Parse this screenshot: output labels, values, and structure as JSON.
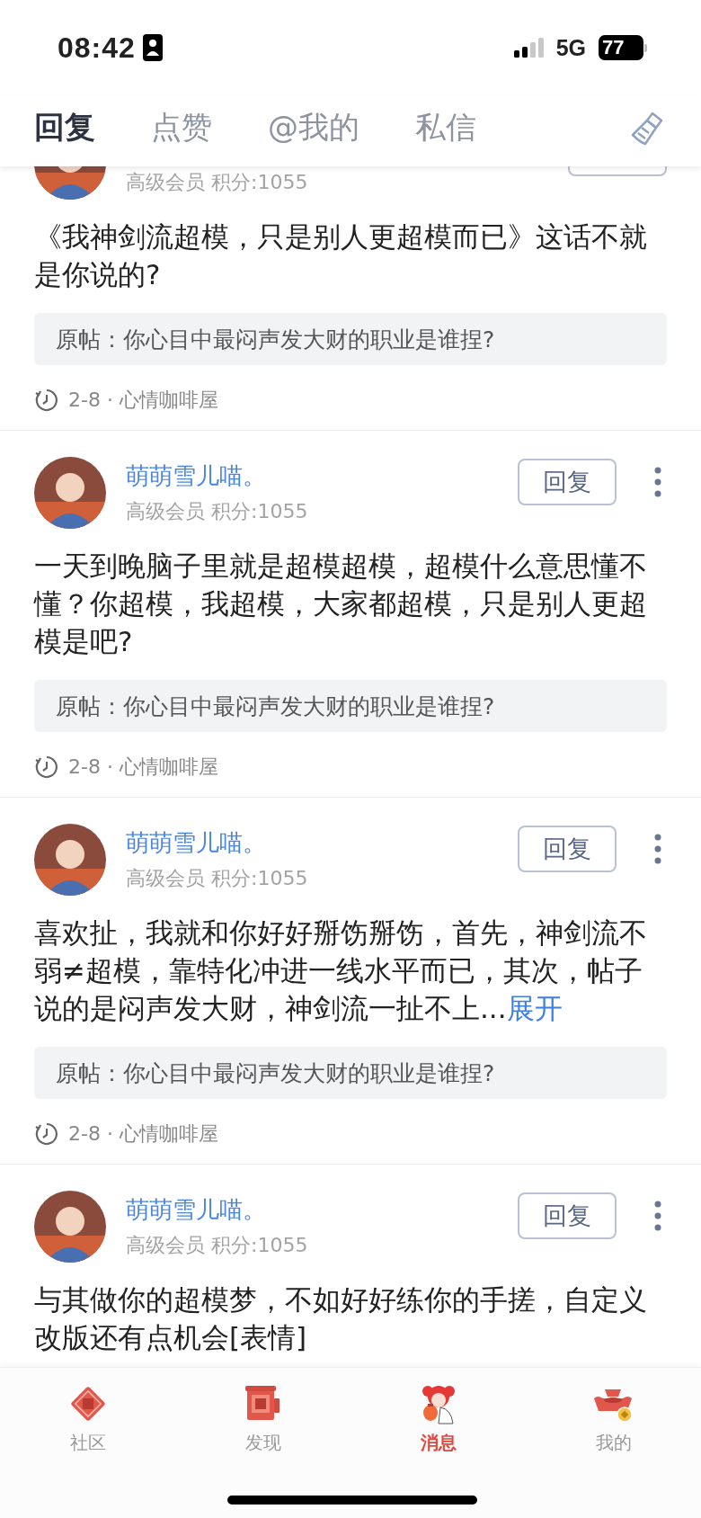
{
  "status_bar": {
    "time": "08:42",
    "network": "5G",
    "battery": "77"
  },
  "tabs": [
    {
      "label": "回复",
      "selected": true
    },
    {
      "label": "点赞",
      "selected": false
    },
    {
      "label": "@我的",
      "selected": false
    },
    {
      "label": "私信",
      "selected": false
    }
  ],
  "replies": [
    {
      "meta": "高级会员 积分:1055",
      "body": "《我神剑流超模，只是别人更超模而已》这话不就是你说的?",
      "origin": "原帖：你心目中最闷声发大财的职业是谁捏?",
      "footer": "2-8 · 心情咖啡屋"
    },
    {
      "name": "萌萌雪儿喵。",
      "meta": "高级会员 积分:1055",
      "reply_label": "回复",
      "body": "一天到晚脑子里就是超模超模，超模什么意思懂不懂？你超模，我超模，大家都超模，只是别人更超模是吧?",
      "origin": "原帖：你心目中最闷声发大财的职业是谁捏?",
      "footer": "2-8 · 心情咖啡屋"
    },
    {
      "name": "萌萌雪儿喵。",
      "meta": "高级会员 积分:1055",
      "reply_label": "回复",
      "body": "喜欢扯，我就和你好好掰饬掰饬，首先，神剑流不弱≠超模，靠特化冲进一线水平而已，其次，帖子说的是闷声发大财，神剑流一扯不上...",
      "expand": "展开",
      "origin": "原帖：你心目中最闷声发大财的职业是谁捏?",
      "footer": "2-8 · 心情咖啡屋"
    },
    {
      "name": "萌萌雪儿喵。",
      "meta": "高级会员 积分:1055",
      "reply_label": "回复",
      "body": "与其做你的超模梦，不如好好练你的手搓，自定义改版还有点机会[表情]"
    }
  ],
  "bottom_nav": [
    {
      "label": "社区",
      "kind": "fu",
      "selected": false
    },
    {
      "label": "发现",
      "kind": "dragon",
      "selected": false
    },
    {
      "label": "消息",
      "kind": "figure",
      "selected": true
    },
    {
      "label": "我的",
      "kind": "ingot",
      "selected": false
    }
  ]
}
